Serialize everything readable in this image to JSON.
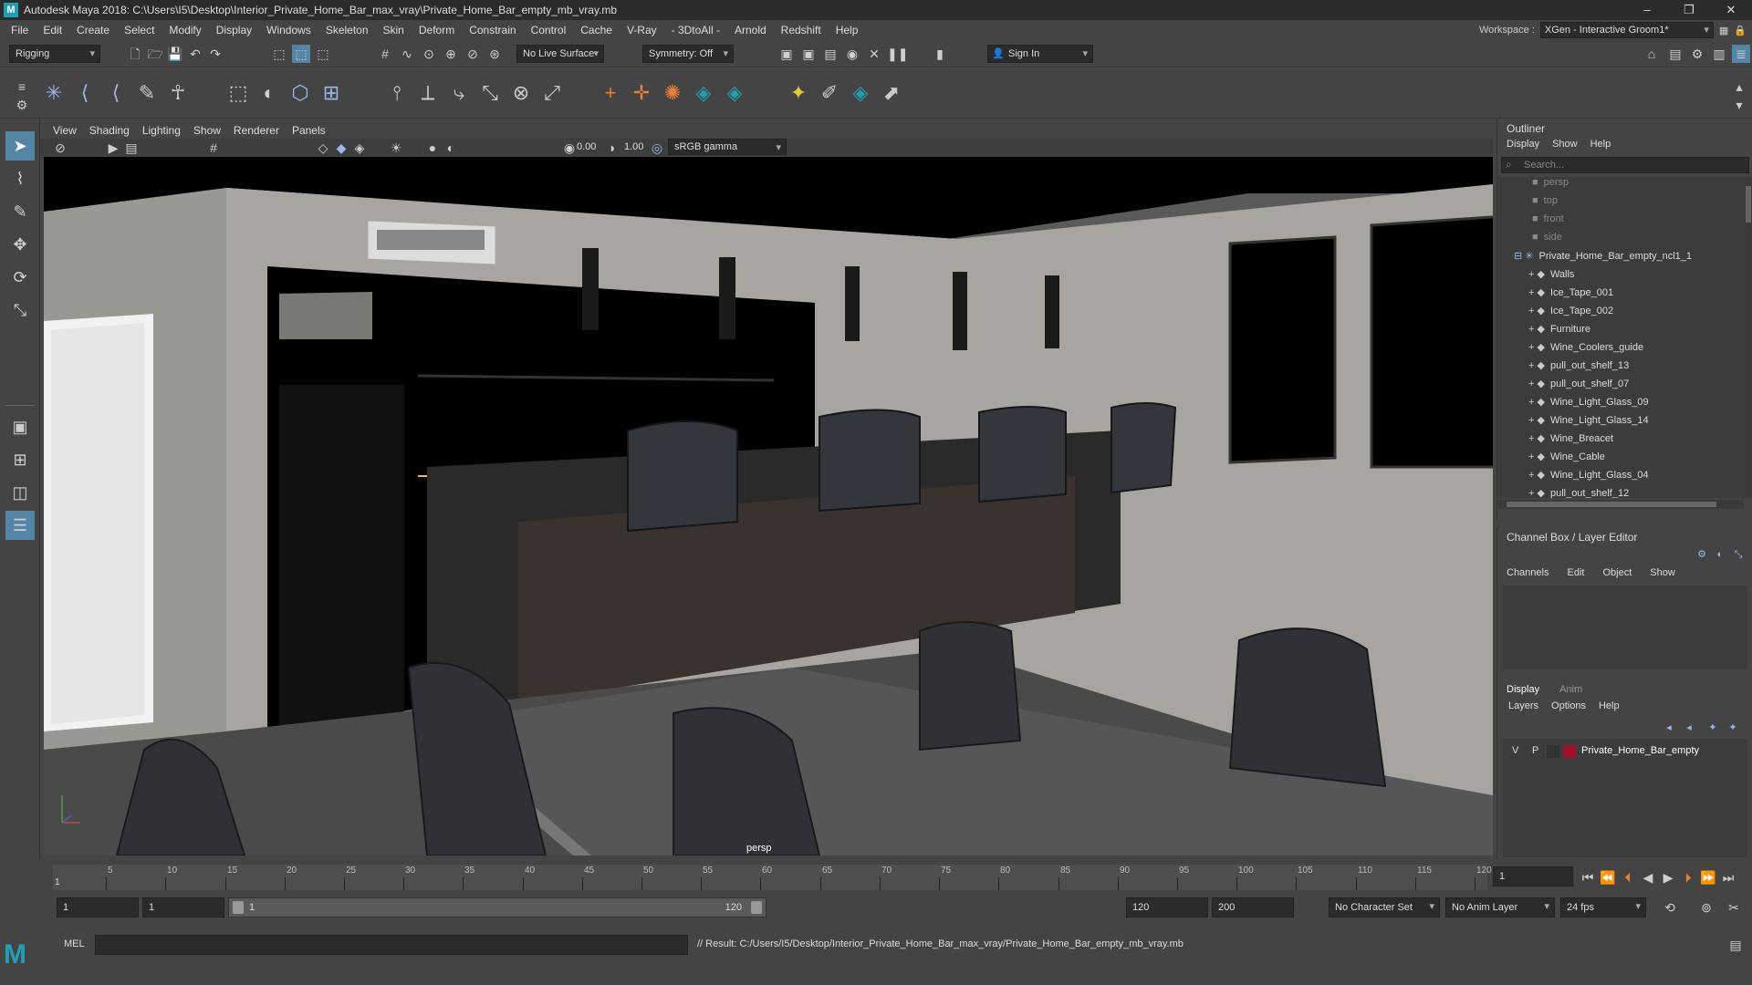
{
  "window": {
    "title": "Autodesk Maya 2018: C:\\Users\\I5\\Desktop\\Interior_Private_Home_Bar_max_vray\\Private_Home_Bar_empty_mb_vray.mb",
    "logo": "M"
  },
  "menubar": {
    "items": [
      "File",
      "Edit",
      "Create",
      "Select",
      "Modify",
      "Display",
      "Windows",
      "Skeleton",
      "Skin",
      "Deform",
      "Constrain",
      "Control",
      "Cache",
      "V-Ray",
      "- 3DtoAll -",
      "Arnold",
      "Redshift",
      "Help"
    ],
    "workspace_label": "Workspace :",
    "workspace_value": "XGen - Interactive Groom1*"
  },
  "statusline": {
    "mode": "Rigging",
    "live_surface": "No Live Surface",
    "symmetry": "Symmetry: Off",
    "sign_in": "Sign In"
  },
  "panel": {
    "menus": [
      "View",
      "Shading",
      "Lighting",
      "Show",
      "Renderer",
      "Panels"
    ],
    "exposure": "0.00",
    "gamma": "1.00",
    "color_space": "sRGB gamma",
    "camera_label": "persp"
  },
  "timeline": {
    "ticks": [
      "5",
      "10",
      "15",
      "20",
      "25",
      "30",
      "35",
      "40",
      "45",
      "50",
      "55",
      "60",
      "65",
      "70",
      "75",
      "80",
      "85",
      "90",
      "95",
      "100",
      "105",
      "110",
      "115",
      "120"
    ],
    "current_frame_marker": "1",
    "current_frame_field": "1"
  },
  "range": {
    "start": "1",
    "playback_start": "1",
    "slider_start": "1",
    "slider_end": "120",
    "playback_end": "120",
    "end": "200",
    "character_set": "No Character Set",
    "anim_layer": "No Anim Layer",
    "fps": "24 fps"
  },
  "cmdline": {
    "lang": "MEL",
    "result": "// Result: C:/Users/I5/Desktop/Interior_Private_Home_Bar_max_vray/Private_Home_Bar_empty_mb_vray.mb"
  },
  "outliner": {
    "title": "Outliner",
    "menus": [
      "Display",
      "Show",
      "Help"
    ],
    "search_placeholder": "Search...",
    "cameras": [
      "persp",
      "top",
      "front",
      "side"
    ],
    "root": "Private_Home_Bar_empty_ncl1_1",
    "children": [
      "Walls",
      "Ice_Tape_001",
      "Ice_Tape_002",
      "Furniture",
      "Wine_Coolers_guide",
      "pull_out_shelf_13",
      "pull_out_shelf_07",
      "Wine_Light_Glass_09",
      "Wine_Light_Glass_14",
      "Wine_Breacet",
      "Wine_Cable",
      "Wine_Light_Glass_04",
      "pull_out_shelf_12"
    ]
  },
  "channelbox": {
    "title": "Channel Box / Layer Editor",
    "menus": [
      "Channels",
      "Edit",
      "Object",
      "Show"
    ],
    "tabs": [
      "Display",
      "Anim"
    ],
    "layer_menus": [
      "Layers",
      "Options",
      "Help"
    ],
    "layer": {
      "v": "V",
      "p": "P",
      "name": "Private_Home_Bar_empty",
      "color": "#a0102a"
    }
  },
  "colors": {
    "accent": "#5285a6",
    "maya_blue": "#1e9fb4"
  }
}
